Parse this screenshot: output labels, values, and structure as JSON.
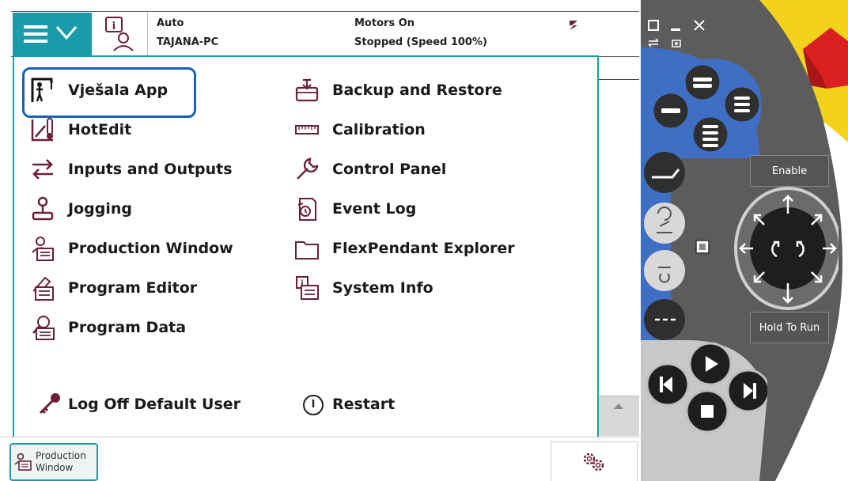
{
  "status": {
    "mode": "Auto",
    "system": "TAJANA-PC",
    "motors": "Motors On",
    "state": "Stopped (Speed 100%)"
  },
  "menu": {
    "left": [
      {
        "label": "Vješala App",
        "icon": "gallows-person-icon"
      },
      {
        "label": "HotEdit",
        "icon": "hotedit-icon"
      },
      {
        "label": "Inputs and Outputs",
        "icon": "io-arrows-icon"
      },
      {
        "label": "Jogging",
        "icon": "joystick-icon"
      },
      {
        "label": "Production Window",
        "icon": "production-window-icon"
      },
      {
        "label": "Program Editor",
        "icon": "program-editor-icon"
      },
      {
        "label": "Program Data",
        "icon": "program-data-icon"
      }
    ],
    "right": [
      {
        "label": "Backup and Restore",
        "icon": "backup-restore-icon"
      },
      {
        "label": "Calibration",
        "icon": "calibration-icon"
      },
      {
        "label": "Control Panel",
        "icon": "wrench-icon"
      },
      {
        "label": "Event Log",
        "icon": "event-log-icon"
      },
      {
        "label": "FlexPendant Explorer",
        "icon": "folder-icon"
      },
      {
        "label": "System Info",
        "icon": "system-info-icon"
      }
    ],
    "logoff": "Log Off Default User",
    "restart": "Restart",
    "selected_index": 0
  },
  "taskbar": {
    "production_window": "Production\nWindow"
  },
  "pendant": {
    "enable": "Enable",
    "hold_to_run": "Hold To Run"
  },
  "colors": {
    "accent": "#1a9bab",
    "selection": "#1662b8",
    "icon": "#6b1f3a",
    "pendant_body": "#5c5c5c",
    "pendant_blue": "#3f6fc4",
    "estop_red": "#d91f1f",
    "estop_yellow": "#f2d21b"
  }
}
